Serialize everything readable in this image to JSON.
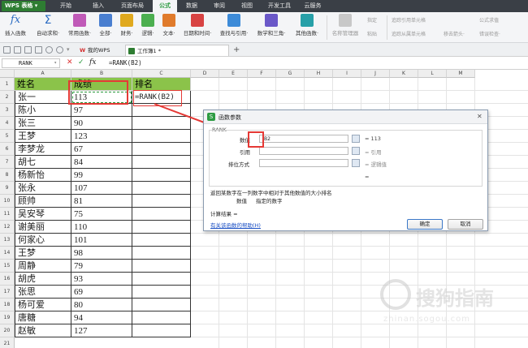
{
  "app": {
    "logo": "WPS 表格",
    "menu": [
      "开始",
      "插入",
      "页面布局",
      "公式",
      "数据",
      "审阅",
      "视图",
      "开发工具",
      "云服务"
    ],
    "active_menu": "公式"
  },
  "ribbon": {
    "buttons": [
      "插入函数",
      "自动求和·",
      "常用函数·",
      "全部·",
      "财务·",
      "逻辑·",
      "文本·",
      "日期和时间·",
      "查找与引用·",
      "数学和三角·",
      "其他函数·",
      "名称管理器"
    ],
    "small_items": [
      "指定",
      "粘贴",
      "追踪引用单元格",
      "追踪从属单元格",
      "移去箭头·",
      "公式求值",
      "错误检查·"
    ],
    "fx_glyph": "fx",
    "sigma_glyph": "Σ"
  },
  "tabs": {
    "my_wps": "我的WPS",
    "workbook": "工作簿1 *",
    "new_tab": "+",
    "wps_glyph": "W"
  },
  "formula_bar": {
    "name_box": "RANK",
    "cancel_glyph": "✕",
    "confirm_glyph": "✓",
    "fx_label": "fx",
    "formula": "=RANK(B2)"
  },
  "sheet": {
    "columns": [
      "A",
      "B",
      "C",
      "D",
      "E",
      "F",
      "G",
      "H",
      "I",
      "J",
      "K",
      "L",
      "M"
    ],
    "row_numbers": [
      "1",
      "2",
      "3",
      "4",
      "5",
      "6",
      "7",
      "8",
      "9",
      "10",
      "11",
      "12",
      "13",
      "14",
      "15",
      "16",
      "17",
      "18",
      "19",
      "20",
      "21",
      "22"
    ],
    "header": [
      "姓名",
      "成绩",
      "排名"
    ],
    "rows": [
      [
        "张一",
        "113",
        "=RANK(B2)"
      ],
      [
        "陈小",
        "97",
        ""
      ],
      [
        "张三",
        "90",
        ""
      ],
      [
        "王梦",
        "123",
        ""
      ],
      [
        "李梦龙",
        "67",
        ""
      ],
      [
        "胡七",
        "84",
        ""
      ],
      [
        "杨新怡",
        "99",
        ""
      ],
      [
        "张永",
        "107",
        ""
      ],
      [
        "顾帅",
        "81",
        ""
      ],
      [
        "吴安琴",
        "75",
        ""
      ],
      [
        "谢美丽",
        "110",
        ""
      ],
      [
        "何家心",
        "101",
        ""
      ],
      [
        "王梦",
        "98",
        ""
      ],
      [
        "周静",
        "79",
        ""
      ],
      [
        "胡虎",
        "93",
        ""
      ],
      [
        "张思",
        "69",
        ""
      ],
      [
        "杨可爱",
        "80",
        ""
      ],
      [
        "唐糖",
        "94",
        ""
      ],
      [
        "赵敏",
        "127",
        ""
      ]
    ]
  },
  "dialog": {
    "title": "函数参数",
    "close_glyph": "✕",
    "group_label": "RANK",
    "args": [
      {
        "label": "数值",
        "value": "B2",
        "result": "= 113"
      },
      {
        "label": "引用",
        "value": "",
        "result": "= 引用"
      },
      {
        "label": "排位方式",
        "value": "",
        "result": "= 逻辑值"
      }
    ],
    "equals": "=",
    "description": "返回某数字在一列数字中相对于其他数值的大小排名",
    "param_name": "数值",
    "param_desc": "指定的数字",
    "calc_result_label": "计算结果 =",
    "help_link": "有关该函数的帮助(H)",
    "ok": "确定",
    "cancel": "取消"
  },
  "watermark": {
    "text": "搜狗指南",
    "sub": "zhinan.sogou.com"
  },
  "colors": {
    "menubar": "#3a3f46",
    "accent_green": "#2a9a3e",
    "header_fill": "#8bc34a",
    "highlight_red": "#e53935"
  }
}
